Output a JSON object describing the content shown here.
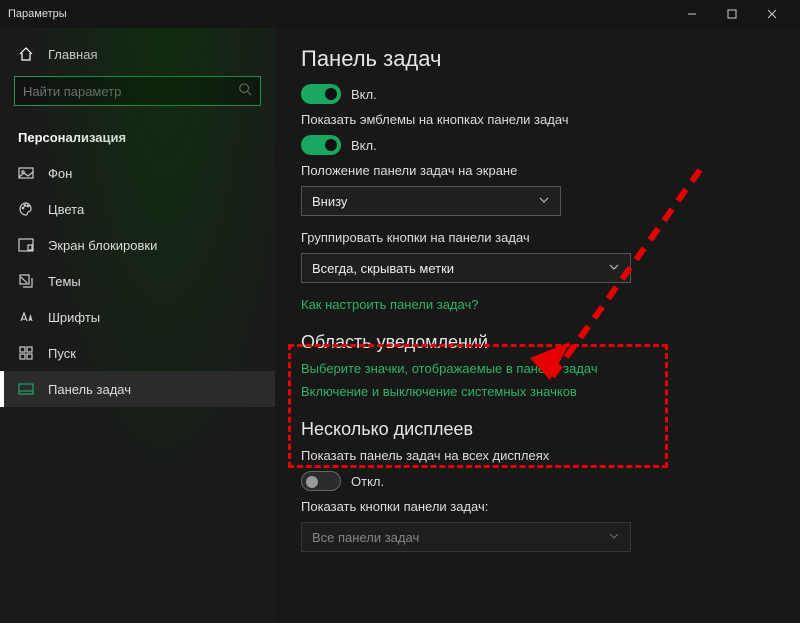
{
  "window": {
    "title": "Параметры"
  },
  "sidebar": {
    "home": "Главная",
    "search_placeholder": "Найти параметр",
    "group": "Персонализация",
    "items": [
      {
        "label": "Фон",
        "icon": "picture"
      },
      {
        "label": "Цвета",
        "icon": "palette"
      },
      {
        "label": "Экран блокировки",
        "icon": "lock"
      },
      {
        "label": "Темы",
        "icon": "themes"
      },
      {
        "label": "Шрифты",
        "icon": "fonts"
      },
      {
        "label": "Пуск",
        "icon": "start"
      },
      {
        "label": "Панель задач",
        "icon": "taskbar"
      }
    ],
    "selected_index": 6
  },
  "main": {
    "title": "Панель задач",
    "toggle1_state": "Вкл.",
    "badges_label": "Показать эмблемы на кнопках панели задач",
    "badges_state": "Вкл.",
    "position_label": "Положение панели задач на экране",
    "position_value": "Внизу",
    "group_label": "Группировать кнопки на панели задач",
    "group_value": "Всегда, скрывать метки",
    "help_link": "Как настроить панели задач?",
    "notif_heading": "Область уведомлений",
    "notif_link1": "Выберите значки, отображаемые в панели задач",
    "notif_link2": "Включение и выключение системных значков",
    "multi_heading": "Несколько дисплеев",
    "multi_show_label": "Показать панель задач на всех дисплеях",
    "multi_show_state": "Откл.",
    "multi_buttons_label": "Показать кнопки панели задач:",
    "multi_buttons_value": "Все панели задач"
  }
}
